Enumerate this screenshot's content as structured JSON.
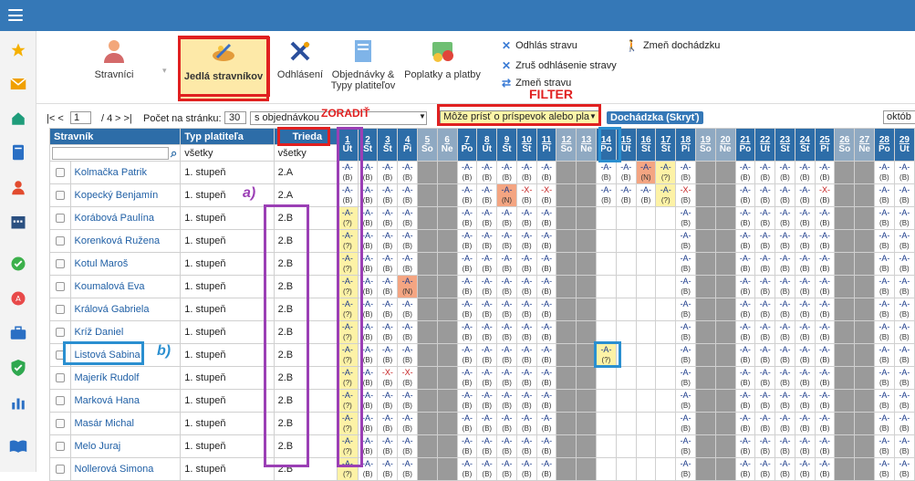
{
  "annotations": {
    "sort": "ZORADIŤ",
    "filter": "FILTER",
    "a": "a)",
    "b": "b)"
  },
  "ribbon": {
    "stravnici": "Stravníci",
    "jedla": "Jedlá stravníkov",
    "odhlasenie": "Odhlásení",
    "objednavky": "Objednávky &",
    "objednavky2": "Typy platiteľov",
    "poplatky": "Poplatky a platby",
    "links": [
      "Odhlás stravu",
      "Zruš odhlásenie stravy",
      "Zmeň stravu",
      "Zmeň dochádzku"
    ]
  },
  "controls": {
    "pager_prefix": "|< <",
    "page": "1",
    "page_total": "/ 4",
    "pager_suffix": "> >|",
    "per_page_label": "Počet na stránku:",
    "per_page": "30",
    "sort_value": "s objednávkou",
    "filter_value": "Môže prísť o príspevok alebo pla",
    "attendance_button": "Dochádzka (Skryť)",
    "right_select": "októb"
  },
  "table": {
    "headers": {
      "stravnik": "Stravník",
      "typ": "Typ platiteľa",
      "trieda": "Trieda"
    },
    "typ_filter": "všetky",
    "trieda_filter": "všetky",
    "day_columns": [
      {
        "n": "1",
        "d": "Ut"
      },
      {
        "n": "2",
        "d": "St"
      },
      {
        "n": "3",
        "d": "Št"
      },
      {
        "n": "4",
        "d": "Pi"
      },
      {
        "n": "5",
        "d": "So"
      },
      {
        "n": "6",
        "d": "Ne"
      },
      {
        "n": "7",
        "d": "Po"
      },
      {
        "n": "8",
        "d": "Ut"
      },
      {
        "n": "9",
        "d": "St"
      },
      {
        "n": "10",
        "d": "Št"
      },
      {
        "n": "11",
        "d": "Pi"
      },
      {
        "n": "12",
        "d": "So"
      },
      {
        "n": "13",
        "d": "Ne"
      },
      {
        "n": "14",
        "d": "Po"
      },
      {
        "n": "15",
        "d": "Ut"
      },
      {
        "n": "16",
        "d": "St"
      },
      {
        "n": "17",
        "d": "Št"
      },
      {
        "n": "18",
        "d": "Pi"
      },
      {
        "n": "19",
        "d": "So"
      },
      {
        "n": "20",
        "d": "Ne"
      },
      {
        "n": "21",
        "d": "Po"
      },
      {
        "n": "22",
        "d": "Ut"
      },
      {
        "n": "23",
        "d": "St"
      },
      {
        "n": "24",
        "d": "Št"
      },
      {
        "n": "25",
        "d": "Pi"
      },
      {
        "n": "26",
        "d": "So"
      },
      {
        "n": "27",
        "d": "Ne"
      },
      {
        "n": "28",
        "d": "Po"
      },
      {
        "n": "29",
        "d": "Ut"
      }
    ],
    "rows": [
      {
        "name": "Kolmačka Patrik",
        "typ": "1. stupeň",
        "trieda": "2.A"
      },
      {
        "name": "Kopecký Benjamín",
        "typ": "1. stupeň",
        "trieda": "2.A"
      },
      {
        "name": "Korábová Paulína",
        "typ": "1. stupeň",
        "trieda": "2.B"
      },
      {
        "name": "Korenková Ružena",
        "typ": "1. stupeň",
        "trieda": "2.B"
      },
      {
        "name": "Kotul Maroš",
        "typ": "1. stupeň",
        "trieda": "2.B"
      },
      {
        "name": "Koumalová Eva",
        "typ": "1. stupeň",
        "trieda": "2.B"
      },
      {
        "name": "Králová Gabriela",
        "typ": "1. stupeň",
        "trieda": "2.B"
      },
      {
        "name": "Kríž Daniel",
        "typ": "1. stupeň",
        "trieda": "2.B"
      },
      {
        "name": "Listová Sabina",
        "typ": "1. stupeň",
        "trieda": "2.B"
      },
      {
        "name": "Majerík Rudolf",
        "typ": "1. stupeň",
        "trieda": "2.B"
      },
      {
        "name": "Marková Hana",
        "typ": "1. stupeň",
        "trieda": "2.B"
      },
      {
        "name": "Masár Michal",
        "typ": "1. stupeň",
        "trieda": "2.B"
      },
      {
        "name": "Melo Juraj",
        "typ": "1. stupeň",
        "trieda": "2.B"
      },
      {
        "name": "Nollerová Simona",
        "typ": "1. stupeň",
        "trieda": "2.B"
      }
    ],
    "meal_code": "-A-",
    "sub_b": "(B)",
    "sub_q": "(?)",
    "sub_n": "(N)",
    "code_x": "-X-"
  }
}
